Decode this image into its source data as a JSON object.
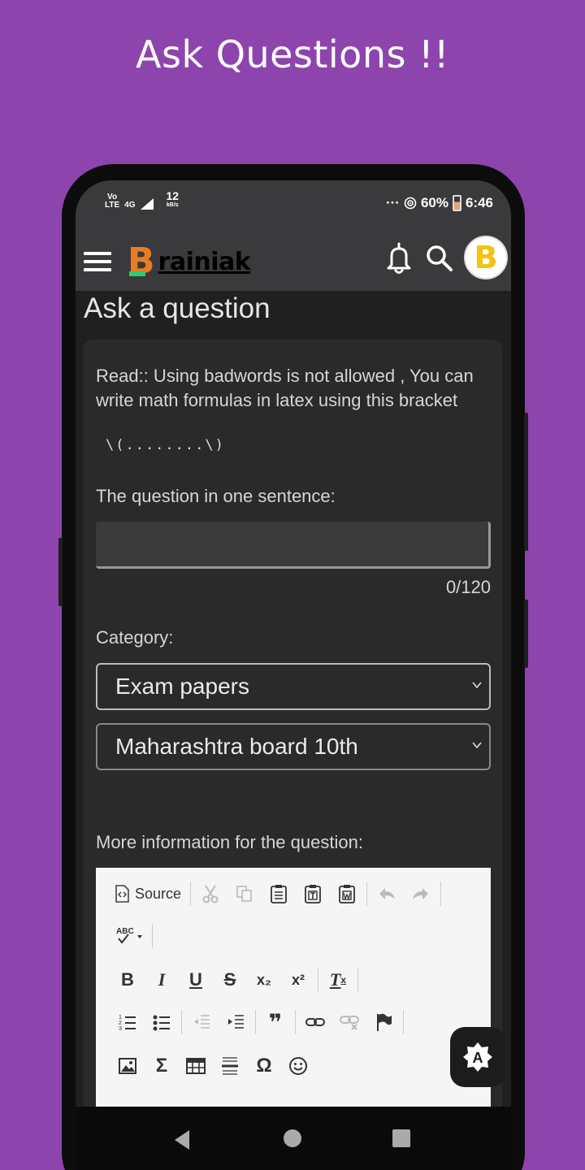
{
  "promo": {
    "title": "Ask Questions !!"
  },
  "status_bar": {
    "volte": "VoLTE",
    "network": "4G",
    "speed_value": "12",
    "speed_unit": "kB/s",
    "dots": "···",
    "battery_percent": "60%",
    "time": "6:46"
  },
  "app_bar": {
    "logo_letter": "B",
    "logo_text": "rainiak",
    "menu_icon": "hamburger-menu-icon",
    "notification_icon": "bell-icon",
    "search_icon": "search-icon",
    "avatar_letter": "B"
  },
  "page": {
    "title": "Ask a question"
  },
  "form": {
    "notice": "Read:: Using badwords is not allowed , You can write math formulas in latex using this bracket",
    "latex_example": "\\(........\\)",
    "question_label": "The question in one sentence:",
    "question_value": "",
    "char_counter": "0/120",
    "category_label": "Category:",
    "category_select": "Exam papers",
    "subcategory_select": "Maharashtra board 10th",
    "more_info_label": "More information for the question:"
  },
  "editor": {
    "source_label": "Source",
    "toolbar_row1": [
      "source-icon",
      "cut-icon",
      "copy-icon",
      "paste-icon",
      "paste-text-icon",
      "paste-word-icon",
      "undo-icon",
      "redo-icon"
    ],
    "spellcheck_label": "ABC",
    "toolbar_row3": [
      "B",
      "I",
      "U",
      "S",
      "x₂",
      "x²",
      "T"
    ],
    "toolbar_row4": [
      "numbered-list-icon",
      "bullet-list-icon",
      "outdent-icon",
      "indent-icon",
      "blockquote-icon",
      "link-icon",
      "unlink-icon",
      "anchor-flag-icon"
    ],
    "toolbar_row5": [
      "image-icon",
      "sigma-icon",
      "table-icon",
      "horizontal-line-icon",
      "omega-icon",
      "smiley-icon"
    ],
    "sigma": "Σ",
    "omega": "Ω",
    "quote": "❞"
  },
  "fab": {
    "icon": "auto-brightness-icon",
    "label": "A"
  },
  "nav": {
    "back": "back-icon",
    "home": "home-icon",
    "recents": "recents-icon"
  },
  "colors": {
    "background": "#8e44ad",
    "appbar": "#3a3a3c",
    "content": "#202020",
    "logo_orange": "#e67e22",
    "logo_green": "#2ecc71"
  }
}
